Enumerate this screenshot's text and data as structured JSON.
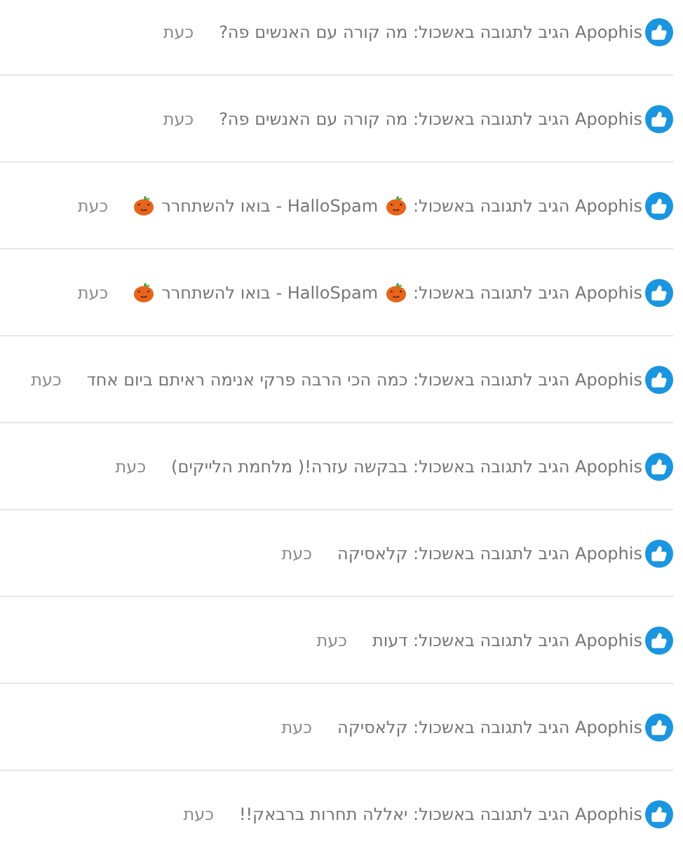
{
  "notifications": [
    {
      "segments": [
        {
          "kind": "text",
          "text": "Apophis הגיב לתגובה באשכול: מה קורה עם האנשים פה?"
        }
      ],
      "time": "כעת"
    },
    {
      "segments": [
        {
          "kind": "text",
          "text": "Apophis הגיב לתגובה באשכול: מה קורה עם האנשים פה?"
        }
      ],
      "time": "כעת"
    },
    {
      "segments": [
        {
          "kind": "text",
          "text": "Apophis הגיב לתגובה באשכול:"
        },
        {
          "kind": "pumpkin"
        },
        {
          "kind": "text",
          "text": "HalloSpam - בואו להשתחרר"
        },
        {
          "kind": "pumpkin"
        }
      ],
      "time": "כעת"
    },
    {
      "segments": [
        {
          "kind": "text",
          "text": "Apophis הגיב לתגובה באשכול:"
        },
        {
          "kind": "pumpkin"
        },
        {
          "kind": "text",
          "text": "HalloSpam - בואו להשתחרר"
        },
        {
          "kind": "pumpkin"
        }
      ],
      "time": "כעת"
    },
    {
      "segments": [
        {
          "kind": "text",
          "text": "Apophis הגיב לתגובה באשכול: כמה הכי הרבה פרקי אנימה ראיתם ביום אחד"
        }
      ],
      "time": "כעת"
    },
    {
      "segments": [
        {
          "kind": "text",
          "text": "Apophis הגיב לתגובה באשכול: בבקשה עזרה!( מלחמת הלייקים)"
        }
      ],
      "time": "כעת"
    },
    {
      "segments": [
        {
          "kind": "text",
          "text": "Apophis הגיב לתגובה באשכול: קלאסיקה"
        }
      ],
      "time": "כעת"
    },
    {
      "segments": [
        {
          "kind": "text",
          "text": "Apophis הגיב לתגובה באשכול: דעות"
        }
      ],
      "time": "כעת"
    },
    {
      "segments": [
        {
          "kind": "text",
          "text": "Apophis הגיב לתגובה באשכול: קלאסיקה"
        }
      ],
      "time": "כעת"
    },
    {
      "segments": [
        {
          "kind": "text",
          "text": "Apophis הגיב לתגובה באשכול: יאללה תחרות ברבאק!!"
        }
      ],
      "time": "כעת"
    }
  ]
}
